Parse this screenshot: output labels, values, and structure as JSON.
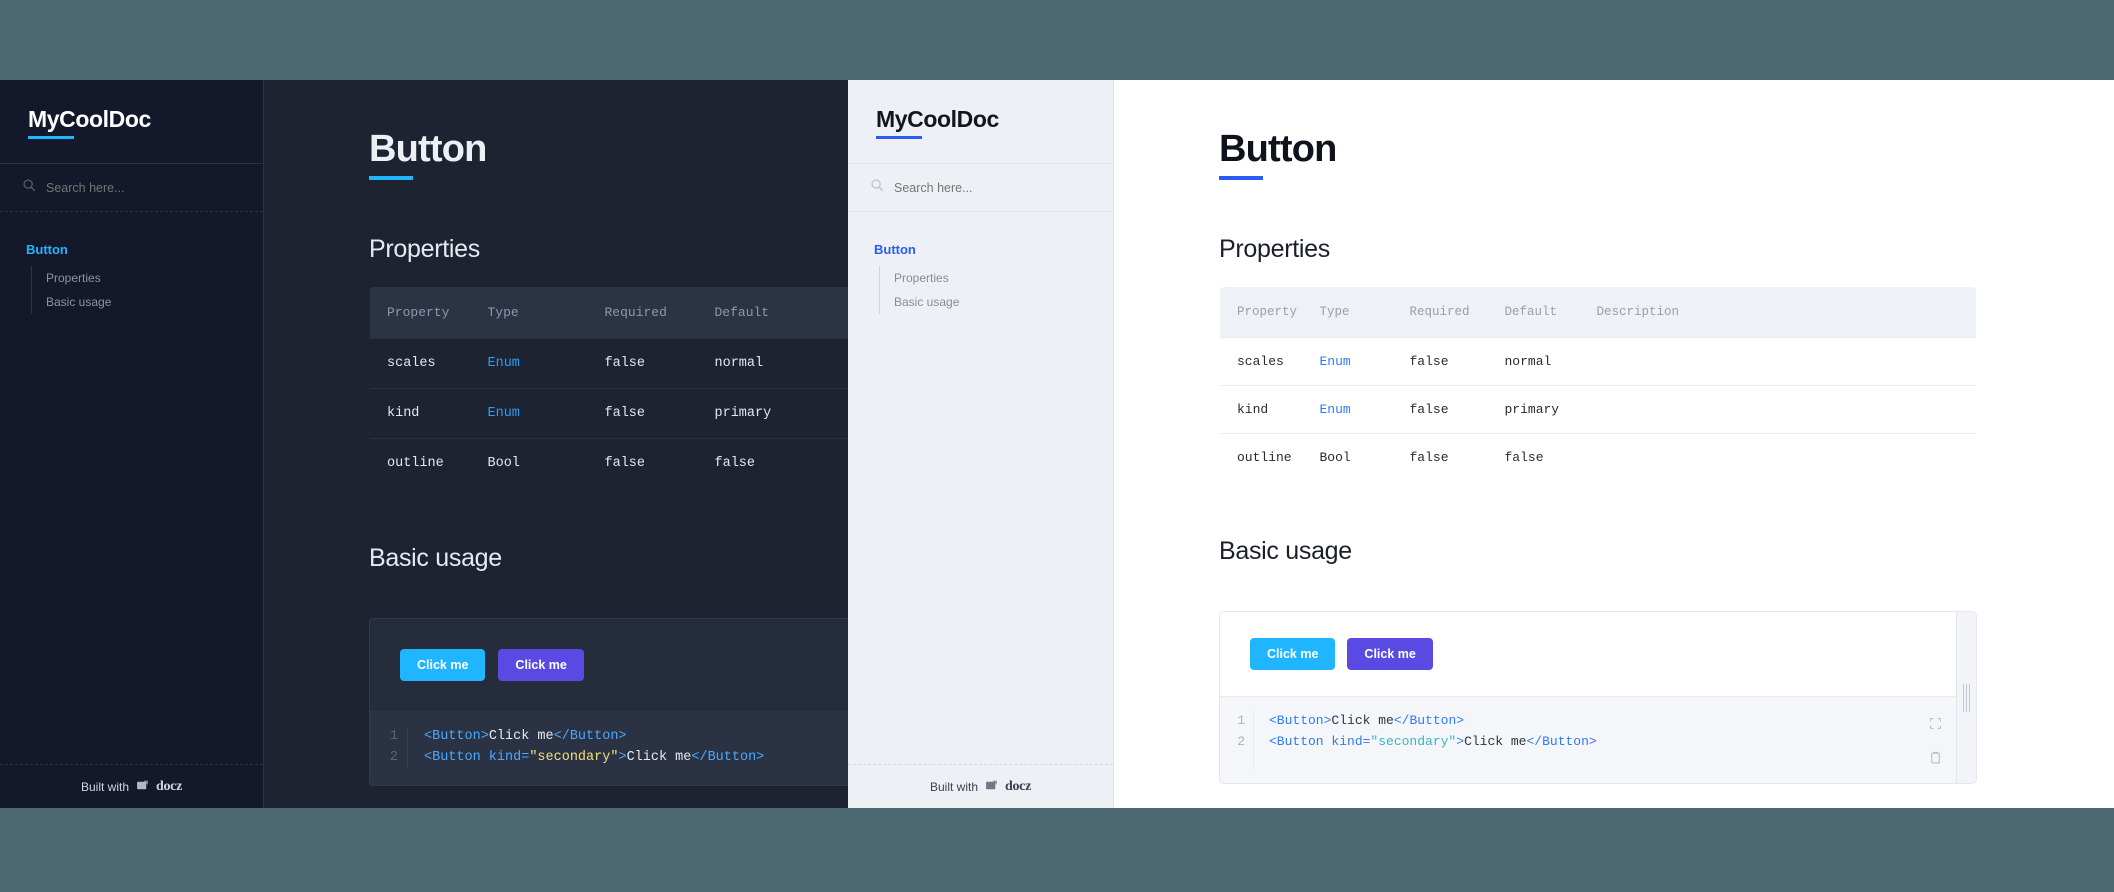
{
  "theme_colors": {
    "page_background": "#4b6872",
    "dark_panel_bg": "#1d2330",
    "dark_sidebar_bg": "#13182a",
    "dark_accent": "#1fb6ff",
    "light_panel_bg": "#ffffff",
    "light_sidebar_bg": "#edf0f5",
    "light_accent": "#2b5cf6",
    "button_primary": "#1fb6ff",
    "button_secondary": "#5a4ae3"
  },
  "dark": {
    "sidebar": {
      "brand": "MyCoolDoc",
      "search": {
        "placeholder": "Search here...",
        "value": "",
        "icon": "search-icon"
      },
      "nav": {
        "active_item": "Button",
        "sub_items": [
          "Properties",
          "Basic usage"
        ]
      },
      "footer": {
        "prefix": "Built with",
        "logo_text": "docz"
      }
    },
    "main": {
      "title": "Button",
      "properties_heading": "Properties",
      "table": {
        "columns": [
          "Property",
          "Type",
          "Required",
          "Default"
        ],
        "rows": [
          {
            "property": "scales",
            "type": "Enum",
            "required": "false",
            "default": "normal"
          },
          {
            "property": "kind",
            "type": "Enum",
            "required": "false",
            "default": "primary"
          },
          {
            "property": "outline",
            "type": "Bool",
            "required": "false",
            "default": "false"
          }
        ]
      },
      "usage_heading": "Basic usage",
      "preview": {
        "primary_button": "Click me",
        "secondary_button": "Click me"
      },
      "code": {
        "line_numbers": [
          "1",
          "2"
        ],
        "line1_open": "<Button>",
        "line1_text": "Click me",
        "line1_close": "</Button>",
        "line2_open": "<Button kind=",
        "line2_string": "\"secondary\"",
        "line2_gt": ">",
        "line2_text": "Click me",
        "line2_close": "</Button>"
      }
    }
  },
  "light": {
    "sidebar": {
      "brand": "MyCoolDoc",
      "search": {
        "placeholder": "Search here...",
        "value": "",
        "icon": "search-icon"
      },
      "nav": {
        "active_item": "Button",
        "sub_items": [
          "Properties",
          "Basic usage"
        ]
      },
      "footer": {
        "prefix": "Built with",
        "logo_text": "docz"
      }
    },
    "main": {
      "title": "Button",
      "properties_heading": "Properties",
      "table": {
        "columns": [
          "Property",
          "Type",
          "Required",
          "Default",
          "Description"
        ],
        "rows": [
          {
            "property": "scales",
            "type": "Enum",
            "required": "false",
            "default": "normal",
            "description": ""
          },
          {
            "property": "kind",
            "type": "Enum",
            "required": "false",
            "default": "primary",
            "description": ""
          },
          {
            "property": "outline",
            "type": "Bool",
            "required": "false",
            "default": "false",
            "description": ""
          }
        ]
      },
      "usage_heading": "Basic usage",
      "preview": {
        "primary_button": "Click me",
        "secondary_button": "Click me"
      },
      "code": {
        "line_numbers": [
          "1",
          "2"
        ],
        "line1_open": "<Button>",
        "line1_text": "Click me",
        "line1_close": "</Button>",
        "line2_open": "<Button kind=",
        "line2_string": "\"secondary\"",
        "line2_gt": ">",
        "line2_text": "Click me",
        "line2_close": "</Button>",
        "icons": [
          "expand-icon",
          "copy-icon"
        ]
      }
    }
  }
}
